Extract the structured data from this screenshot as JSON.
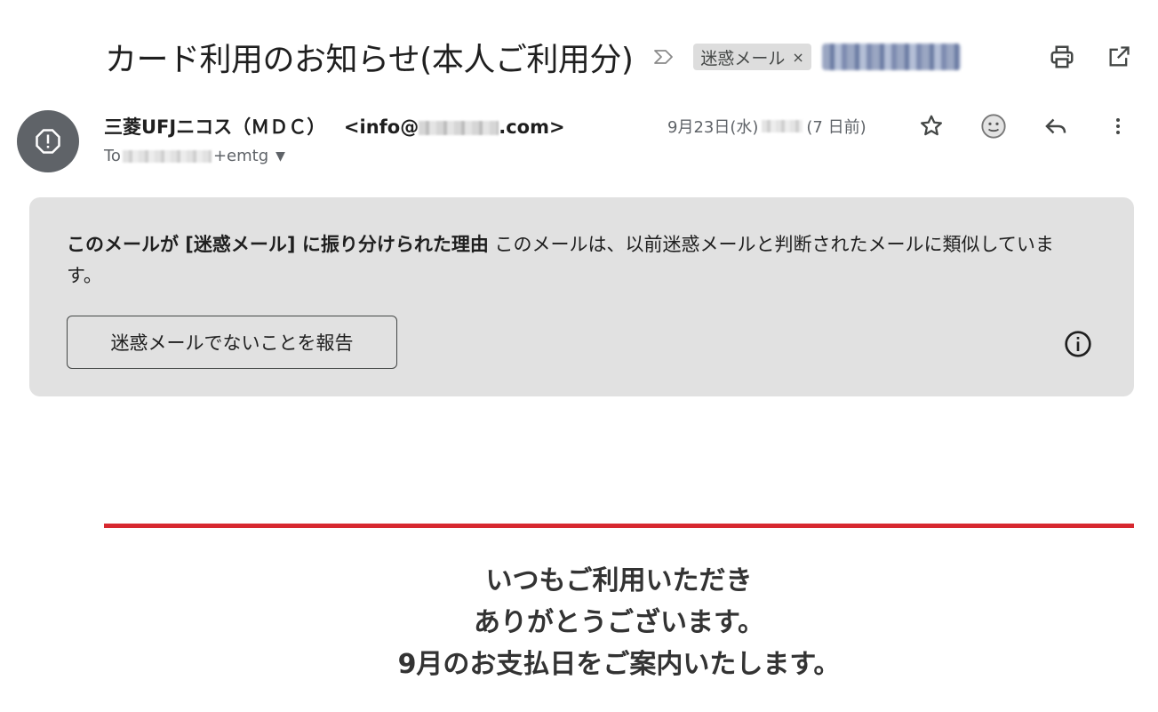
{
  "email": {
    "subject": "カード利用のお知らせ(本人ご利用分)",
    "labels": [
      {
        "text": "迷惑メール",
        "remove": "×"
      }
    ]
  },
  "sender": {
    "name": "三菱UFJニコス（ＭＤＣ）",
    "email_prefix": "<info@",
    "email_suffix": ".com>",
    "to_prefix": "To",
    "to_suffix": "+emtg",
    "date_prefix": "9月23日(水)",
    "date_suffix": "(7 日前)"
  },
  "spam_banner": {
    "reason_title": "このメールが [迷惑メール] に振り分けられた理由",
    "reason_body": "このメールは、以前迷惑メールと判断されたメールに類似しています。",
    "not_spam_button": "迷惑メールでないことを報告"
  },
  "body": {
    "lines": [
      "いつもご利用いただき",
      "ありがとうございます。",
      "9月のお支払日をご案内いたします。"
    ],
    "accent_color": "#d7282f"
  },
  "icons": {
    "header": [
      "label-arrow-icon",
      "print-icon",
      "open-in-new-icon"
    ],
    "message": [
      "star-icon",
      "emoji-icon",
      "reply-icon",
      "more-vert-icon"
    ],
    "avatar": "spam-warning-icon",
    "banner": "info-icon"
  }
}
